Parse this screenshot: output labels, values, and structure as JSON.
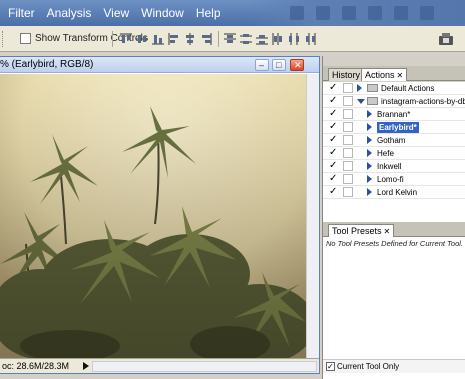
{
  "menu": [
    "Filter",
    "Analysis",
    "View",
    "Window",
    "Help"
  ],
  "options_bar": {
    "show_transform_controls": "Show Transform Controls"
  },
  "document": {
    "title": "% (Earlybird, RGB/8)",
    "status": "oc: 28.6M/28.3M"
  },
  "actions_panel": {
    "tabs": [
      {
        "label": "History",
        "active": false
      },
      {
        "label": "Actions",
        "active": true
      }
    ],
    "items": [
      {
        "label": "Default Actions",
        "level": 0,
        "checked": true,
        "expanded": false,
        "folder": true,
        "selected": false
      },
      {
        "label": "instagram-actions-by-dbox",
        "level": 0,
        "checked": true,
        "expanded": true,
        "folder": true,
        "selected": false
      },
      {
        "label": "Brannan*",
        "level": 1,
        "checked": true,
        "expanded": false,
        "folder": false,
        "selected": false
      },
      {
        "label": "Earlybird*",
        "level": 1,
        "checked": true,
        "expanded": false,
        "folder": false,
        "selected": true
      },
      {
        "label": "Gotham",
        "level": 1,
        "checked": true,
        "expanded": false,
        "folder": false,
        "selected": false
      },
      {
        "label": "Hefe",
        "level": 1,
        "checked": true,
        "expanded": false,
        "folder": false,
        "selected": false
      },
      {
        "label": "Inkwell",
        "level": 1,
        "checked": true,
        "expanded": false,
        "folder": false,
        "selected": false
      },
      {
        "label": "Lomo-fi",
        "level": 1,
        "checked": true,
        "expanded": false,
        "folder": false,
        "selected": false
      },
      {
        "label": "Lord Kelvin",
        "level": 1,
        "checked": true,
        "expanded": false,
        "folder": false,
        "selected": false
      }
    ]
  },
  "tool_presets_panel": {
    "tab": "Tool Presets",
    "message": "No Tool Presets Defined for Current Tool.",
    "current_tool_only": "Current Tool Only",
    "current_tool_only_checked": true
  },
  "colors": {
    "menu_bar": "#5a7db5",
    "selection": "#3264c8",
    "photo_sky": "#efe4b9"
  }
}
